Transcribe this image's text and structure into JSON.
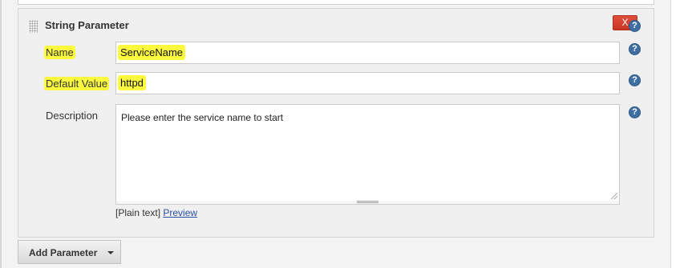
{
  "section": {
    "title": "String Parameter",
    "delete_label": "X"
  },
  "fields": {
    "name": {
      "label": "Name",
      "value": "ServiceName"
    },
    "default_value": {
      "label": "Default Value",
      "value": "httpd"
    },
    "description": {
      "label": "Description",
      "value": "Please enter the service name to start"
    }
  },
  "format": {
    "plain_text": "[Plain text]",
    "preview_link": "Preview"
  },
  "actions": {
    "add_parameter": "Add Parameter"
  },
  "icons": {
    "help": "?",
    "help_icon": "help-icon",
    "drag_handle_icon": "drag-handle-icon",
    "caret": "chevron-down-icon"
  },
  "colors": {
    "highlight": "#fbfa3f",
    "delete_button": "#d9412e",
    "help_icon": "#3f6ea0",
    "link": "#2a4fa8"
  }
}
